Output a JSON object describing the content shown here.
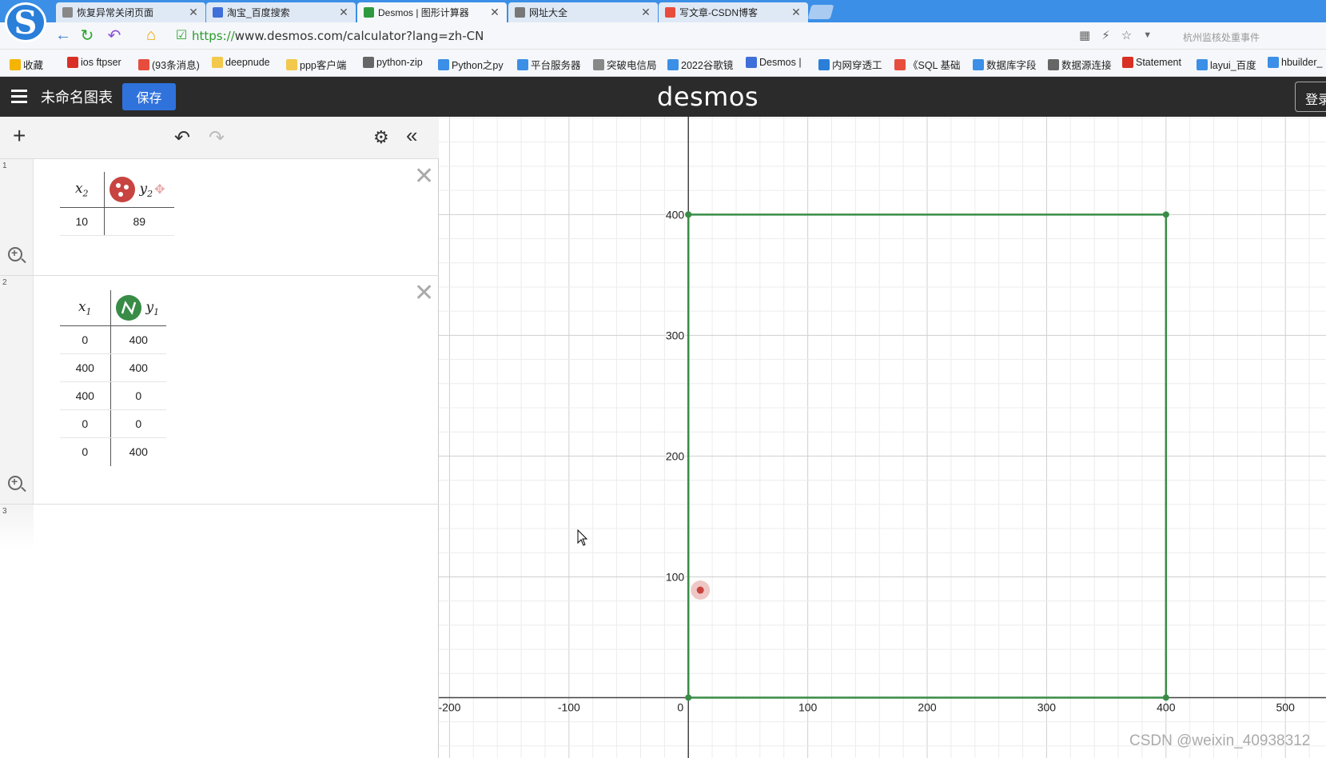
{
  "browser": {
    "tabs": [
      {
        "label": "恢复异常关闭页面",
        "icon_color": "#888888",
        "active": false
      },
      {
        "label": "淘宝_百度搜索",
        "icon_color": "#3f6fd8",
        "active": false
      },
      {
        "label": "Desmos | 图形计算器",
        "icon_color": "#2e9a3f",
        "active": true
      },
      {
        "label": "网址大全",
        "icon_color": "#777777",
        "active": false
      },
      {
        "label": "写文章-CSDN博客",
        "icon_color": "#e84c3d",
        "active": false
      }
    ],
    "url_scheme": "https://",
    "url_rest": "www.desmos.com/calculator?lang=zh-CN",
    "search_hint": "杭州监核处重事件",
    "bookmarks": [
      {
        "label": "收藏",
        "icon_color": "#f4b400"
      },
      {
        "label": "ios ftpser",
        "icon_color": "#d93025"
      },
      {
        "label": "(93条消息)",
        "icon_color": "#e84c3d"
      },
      {
        "label": "deepnude",
        "icon_color": "#f2c94c"
      },
      {
        "label": "ppp客户端",
        "icon_color": "#f2c94c"
      },
      {
        "label": "python-zip",
        "icon_color": "#666666"
      },
      {
        "label": "Python之py",
        "icon_color": "#3b8fe6"
      },
      {
        "label": "平台服务器",
        "icon_color": "#3b8fe6"
      },
      {
        "label": "突破电信局",
        "icon_color": "#888888"
      },
      {
        "label": "2022谷歌镜",
        "icon_color": "#3b8fe6"
      },
      {
        "label": "Desmos |",
        "icon_color": "#3f6fd8"
      },
      {
        "label": "内网穿透工",
        "icon_color": "#2a7fd9"
      },
      {
        "label": "《SQL 基础",
        "icon_color": "#e84c3d"
      },
      {
        "label": "数据库字段",
        "icon_color": "#3b8fe6"
      },
      {
        "label": "数据源连接",
        "icon_color": "#666666"
      },
      {
        "label": "Statement",
        "icon_color": "#d93025"
      },
      {
        "label": "layui_百度",
        "icon_color": "#3b8fe6"
      },
      {
        "label": "hbuilder_",
        "icon_color": "#3b8fe6"
      }
    ]
  },
  "app": {
    "graph_title": "未命名图表",
    "save_label": "保存",
    "brand": "desmos",
    "login_label": "登录"
  },
  "expressions": [
    {
      "num": "1",
      "x_var": "x",
      "x_sub": "2",
      "y_var": "y",
      "y_sub": "2",
      "style": "points",
      "color": "#c74440",
      "rows": [
        [
          "10",
          "89"
        ]
      ]
    },
    {
      "num": "2",
      "x_var": "x",
      "x_sub": "1",
      "y_var": "y",
      "y_sub": "1",
      "style": "lines",
      "color": "#388c46",
      "rows": [
        [
          "0",
          "400"
        ],
        [
          "400",
          "400"
        ],
        [
          "400",
          "0"
        ],
        [
          "0",
          "0"
        ],
        [
          "0",
          "400"
        ]
      ]
    },
    {
      "num": "3"
    }
  ],
  "graph": {
    "x_ticks": [
      "-200",
      "-100",
      "0",
      "100",
      "200",
      "300",
      "400",
      "500"
    ],
    "y_ticks": [
      "100",
      "200",
      "300",
      "400"
    ],
    "x_range": [
      -209,
      534
    ],
    "y_range": [
      -50,
      481
    ],
    "polyline": [
      [
        0,
        400
      ],
      [
        400,
        400
      ],
      [
        400,
        0
      ],
      [
        0,
        0
      ],
      [
        0,
        400
      ]
    ],
    "point": [
      10,
      89
    ],
    "line_color": "#388c46",
    "point_color": "#c74440"
  },
  "watermark": "CSDN @weixin_40938312"
}
